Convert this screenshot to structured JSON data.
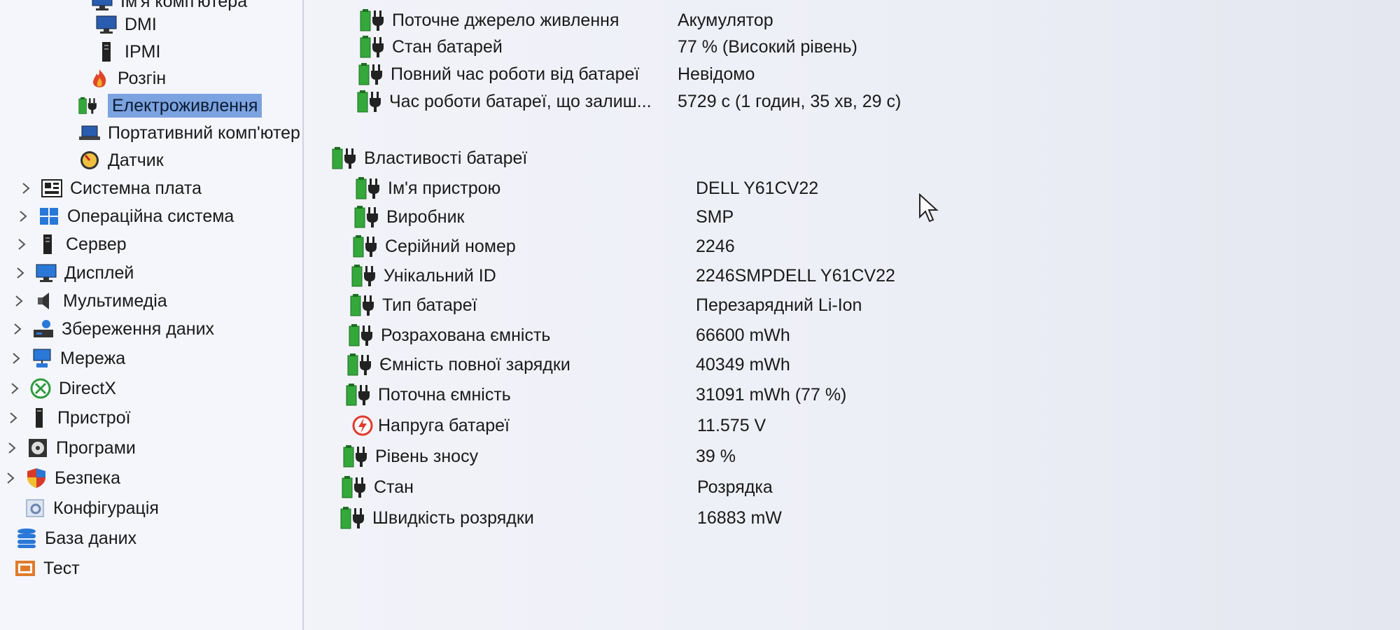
{
  "sidebar": {
    "items": [
      {
        "label": "Ім'я комп'ютера",
        "icon": "computer-icon"
      },
      {
        "label": "DMI",
        "icon": "monitor-icon"
      },
      {
        "label": "IPMI",
        "icon": "server-icon"
      },
      {
        "label": "Розгін",
        "icon": "flame-icon"
      },
      {
        "label": "Електроживлення",
        "icon": "battery-plug-icon",
        "selected": true
      },
      {
        "label": "Портативний комп'ютер",
        "icon": "laptop-icon"
      },
      {
        "label": "Датчик",
        "icon": "gauge-icon"
      },
      {
        "label": "Системна плата",
        "icon": "motherboard-icon"
      },
      {
        "label": "Операційна система",
        "icon": "windows-icon"
      },
      {
        "label": "Сервер",
        "icon": "server-icon"
      },
      {
        "label": "Дисплей",
        "icon": "monitor-icon"
      },
      {
        "label": "Мультимедіа",
        "icon": "speaker-icon"
      },
      {
        "label": "Збереження даних",
        "icon": "hard-drive-icon"
      },
      {
        "label": "Мережа",
        "icon": "network-icon"
      },
      {
        "label": "DirectX",
        "icon": "xbox-icon"
      },
      {
        "label": "Пристрої",
        "icon": "device-icon"
      },
      {
        "label": "Програми",
        "icon": "disc-icon"
      },
      {
        "label": "Безпека",
        "icon": "shield-icon"
      },
      {
        "label": "Конфігурація",
        "icon": "config-icon"
      },
      {
        "label": "База даних",
        "icon": "database-icon"
      },
      {
        "label": "Тест",
        "icon": "benchmark-icon"
      }
    ]
  },
  "power": {
    "rows": [
      {
        "field": "Поточне джерело живлення",
        "value": "Акумулятор"
      },
      {
        "field": "Стан батарей",
        "value": "77 % (Високий рівень)"
      },
      {
        "field": "Повний час роботи від батареї",
        "value": "Невідомо"
      },
      {
        "field": "Час роботи батареї, що залиш...",
        "value": "5729 с (1 годин, 35 хв, 29 с)"
      }
    ]
  },
  "battery": {
    "group_label": "Властивості батареї",
    "rows": [
      {
        "field": "Ім'я пристрою",
        "value": "DELL Y61CV22",
        "icon": "battery-plug-icon"
      },
      {
        "field": "Виробник",
        "value": "SMP",
        "icon": "battery-plug-icon"
      },
      {
        "field": "Серійний номер",
        "value": "2246",
        "icon": "battery-plug-icon"
      },
      {
        "field": "Унікальний ID",
        "value": "2246SMPDELL Y61CV22",
        "icon": "battery-plug-icon"
      },
      {
        "field": "Тип батареї",
        "value": "Перезарядний Li-Ion",
        "icon": "battery-plug-icon"
      },
      {
        "field": "Розрахована ємність",
        "value": "66600 mWh",
        "icon": "battery-plug-icon"
      },
      {
        "field": "Ємність повної зарядки",
        "value": "40349 mWh",
        "icon": "battery-plug-icon"
      },
      {
        "field": "Поточна ємність",
        "value": "31091 mWh  (77 %)",
        "icon": "battery-plug-icon"
      },
      {
        "field": "Напруга батареї",
        "value": "11.575 V",
        "icon": "voltage-icon"
      },
      {
        "field": "Рівень зносу",
        "value": "39 %",
        "icon": "battery-plug-icon"
      },
      {
        "field": "Стан",
        "value": "Розрядка",
        "icon": "battery-plug-icon"
      },
      {
        "field": "Швидкість розрядки",
        "value": "16883 mW",
        "icon": "battery-plug-icon"
      }
    ]
  },
  "colors": {
    "battery_green": "#34a83a",
    "selection": "#7ba3df",
    "background": "#eef0f7"
  }
}
